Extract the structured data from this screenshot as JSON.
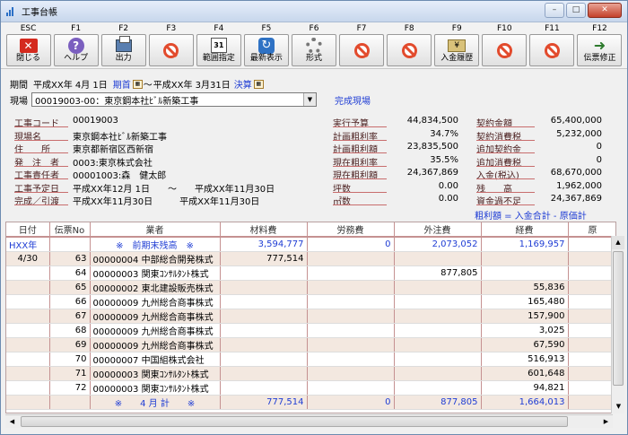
{
  "window": {
    "title": "工事台帳",
    "minimize": "–",
    "maximize": "□",
    "close": "✕"
  },
  "toolbar": [
    {
      "key": "ESC",
      "label": "閉じる",
      "icon": "esc-icon"
    },
    {
      "key": "F1",
      "label": "ヘルプ",
      "icon": "help-icon"
    },
    {
      "key": "F2",
      "label": "出力",
      "icon": "print-icon"
    },
    {
      "key": "F3",
      "label": "",
      "icon": "disabled-icon"
    },
    {
      "key": "F4",
      "label": "範囲指定",
      "icon": "calendar-icon"
    },
    {
      "key": "F5",
      "label": "最新表示",
      "icon": "refresh-icon"
    },
    {
      "key": "F6",
      "label": "形式",
      "icon": "gear-icon"
    },
    {
      "key": "F7",
      "label": "",
      "icon": "disabled-icon"
    },
    {
      "key": "F8",
      "label": "",
      "icon": "disabled-icon"
    },
    {
      "key": "F9",
      "label": "入金履歴",
      "icon": "money-icon"
    },
    {
      "key": "F10",
      "label": "",
      "icon": "disabled-icon"
    },
    {
      "key": "F11",
      "label": "",
      "icon": "disabled-icon"
    },
    {
      "key": "F12",
      "label": "伝票修正",
      "icon": "arrow-icon"
    }
  ],
  "period": {
    "label": "期間",
    "from": "平成XX年 4月 1日",
    "from_btn": "期首",
    "sep": "～",
    "to": "平成XX年 3月31日",
    "to_btn": "決算"
  },
  "site": {
    "label": "現場",
    "value": "00019003-00：東京鋼本社ﾋﾞﾙ新築工事",
    "status": "完成現場"
  },
  "info_left": [
    {
      "label": "工事コード",
      "value": "00019003"
    },
    {
      "label": "現場名",
      "value": "東京鋼本社ﾋﾞﾙ新築工事"
    },
    {
      "label": "住　　所",
      "value": "東京都新宿区西新宿"
    },
    {
      "label": "発　注　者",
      "value": "0003:東京株式会社"
    },
    {
      "label": "工事責任者",
      "value": "00001003:森　健太郎"
    },
    {
      "label": "工事予定日",
      "value": "平成XX年12月 1日　　～　　平成XX年11月30日"
    },
    {
      "label": "完成／引渡",
      "value": "平成XX年11月30日　　　平成XX年11月30日"
    }
  ],
  "info_mid": [
    {
      "label": "実行予算",
      "value": "44,834,500"
    },
    {
      "label": "計画粗利率",
      "value": "34.7%"
    },
    {
      "label": "計画粗利額",
      "value": "23,835,500"
    },
    {
      "label": "現在粗利率",
      "value": "35.5%"
    },
    {
      "label": "現在粗利額",
      "value": "24,367,869"
    },
    {
      "label": "坪数",
      "value": "0.00"
    },
    {
      "label": "㎡数",
      "value": "0.00"
    }
  ],
  "info_right": [
    {
      "label": "契約金額",
      "value": "65,400,000"
    },
    {
      "label": "契約消費税",
      "value": "5,232,000"
    },
    {
      "label": "追加契約金",
      "value": "0"
    },
    {
      "label": "追加消費税",
      "value": "0"
    },
    {
      "label": "入金(税込)",
      "value": "68,670,000"
    },
    {
      "label": "残　　高",
      "value": "1,962,000"
    },
    {
      "label": "資金過不足",
      "value": "24,367,869"
    }
  ],
  "formula": "粗利額 = 入金合計 - 原価計",
  "grid": {
    "headers": [
      "日付",
      "伝票No",
      "業者",
      "材料費",
      "労務費",
      "外注費",
      "経費",
      "原"
    ],
    "rows": [
      {
        "type": "summ",
        "cells": [
          "HXX年",
          "",
          "※　前期末残高　※",
          "3,594,777",
          "0",
          "2,073,052",
          "1,169,957",
          ""
        ]
      },
      {
        "type": "data",
        "cells": [
          "4/30",
          "63",
          "00000004 中部総合開発株式",
          "777,514",
          "",
          "",
          "",
          ""
        ]
      },
      {
        "type": "data",
        "cells": [
          "",
          "64",
          "00000003 関東ｺﾝｻﾙﾀﾝﾄ株式",
          "",
          "",
          "877,805",
          "",
          ""
        ]
      },
      {
        "type": "data",
        "cells": [
          "",
          "65",
          "00000002 東北建設販売株式",
          "",
          "",
          "",
          "55,836",
          ""
        ]
      },
      {
        "type": "data",
        "cells": [
          "",
          "66",
          "00000009 九州総合商事株式",
          "",
          "",
          "",
          "165,480",
          ""
        ]
      },
      {
        "type": "data",
        "cells": [
          "",
          "67",
          "00000009 九州総合商事株式",
          "",
          "",
          "",
          "157,900",
          ""
        ]
      },
      {
        "type": "data",
        "cells": [
          "",
          "68",
          "00000009 九州総合商事株式",
          "",
          "",
          "",
          "3,025",
          ""
        ]
      },
      {
        "type": "data",
        "cells": [
          "",
          "69",
          "00000009 九州総合商事株式",
          "",
          "",
          "",
          "67,590",
          ""
        ]
      },
      {
        "type": "data",
        "cells": [
          "",
          "70",
          "00000007 中国組株式会社",
          "",
          "",
          "",
          "516,913",
          ""
        ]
      },
      {
        "type": "data",
        "cells": [
          "",
          "71",
          "00000003 関東ｺﾝｻﾙﾀﾝﾄ株式",
          "",
          "",
          "",
          "601,648",
          ""
        ]
      },
      {
        "type": "data",
        "cells": [
          "",
          "72",
          "00000003 関東ｺﾝｻﾙﾀﾝﾄ株式",
          "",
          "",
          "",
          "94,821",
          ""
        ]
      },
      {
        "type": "summ",
        "cells": [
          "",
          "",
          "※　　4 月 計　　※",
          "777,514",
          "0",
          "877,805",
          "1,664,013",
          ""
        ]
      }
    ]
  }
}
